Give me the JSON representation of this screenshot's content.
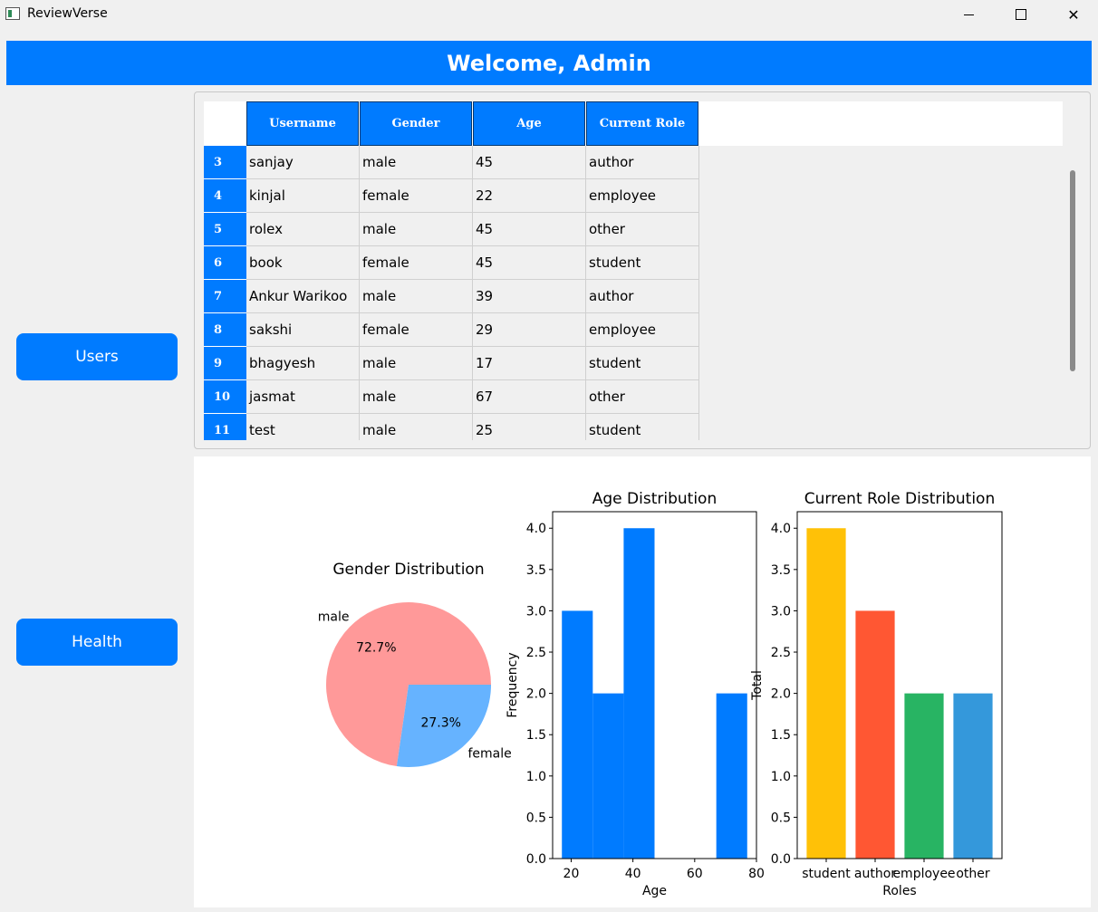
{
  "window": {
    "title": "ReviewVerse",
    "controls": {
      "minimize": "",
      "maximize": "",
      "close": "✕"
    }
  },
  "header": {
    "title": "Welcome, Admin"
  },
  "sidebar": {
    "users_label": "Users",
    "health_label": "Health"
  },
  "table": {
    "columns": [
      "Username",
      "Gender",
      "Age",
      "Current Role"
    ],
    "rows": [
      {
        "id": "3",
        "cells": [
          "sanjay",
          "male",
          "45",
          "author"
        ]
      },
      {
        "id": "4",
        "cells": [
          "kinjal",
          "female",
          "22",
          "employee"
        ]
      },
      {
        "id": "5",
        "cells": [
          "rolex",
          "male",
          "45",
          "other"
        ]
      },
      {
        "id": "6",
        "cells": [
          "book",
          "female",
          "45",
          "student"
        ]
      },
      {
        "id": "7",
        "cells": [
          "Ankur Warikoo",
          "male",
          "39",
          "author"
        ]
      },
      {
        "id": "8",
        "cells": [
          "sakshi",
          "female",
          "29",
          "employee"
        ]
      },
      {
        "id": "9",
        "cells": [
          "bhagyesh",
          "male",
          "17",
          "student"
        ]
      },
      {
        "id": "10",
        "cells": [
          "jasmat",
          "male",
          "67",
          "other"
        ]
      },
      {
        "id": "11",
        "cells": [
          "test",
          "male",
          "25",
          "student"
        ]
      }
    ]
  },
  "chart_data": [
    {
      "type": "pie",
      "title": "Gender Distribution",
      "categories": [
        "male",
        "female"
      ],
      "values": [
        72.7,
        27.3
      ],
      "value_labels": [
        "72.7%",
        "27.3%"
      ],
      "colors": [
        "#ff9999",
        "#66b3ff"
      ]
    },
    {
      "type": "bar",
      "title": "Age Distribution",
      "xlabel": "Age",
      "ylabel": "Frequency",
      "bins": [
        [
          17,
          27
        ],
        [
          27,
          37
        ],
        [
          37,
          47
        ],
        [
          47,
          57
        ],
        [
          57,
          67
        ],
        [
          67,
          77
        ]
      ],
      "values": [
        3,
        2,
        4,
        0,
        0,
        2
      ],
      "xlim": [
        14,
        80
      ],
      "ylim": [
        0,
        4.2
      ],
      "xticks": [
        "20",
        "40",
        "60",
        "80"
      ],
      "xtick_values": [
        20,
        40,
        60,
        80
      ],
      "yticks": [
        "0.0",
        "0.5",
        "1.0",
        "1.5",
        "2.0",
        "2.5",
        "3.0",
        "3.5",
        "4.0"
      ],
      "color": "#007bff"
    },
    {
      "type": "bar",
      "title": "Current Role Distribution",
      "xlabel": "Roles",
      "ylabel": "Total",
      "categories": [
        "student",
        "author",
        "employee",
        "other"
      ],
      "values": [
        4,
        3,
        2,
        2
      ],
      "ylim": [
        0,
        4.2
      ],
      "yticks": [
        "0.0",
        "0.5",
        "1.0",
        "1.5",
        "2.0",
        "2.5",
        "3.0",
        "3.5",
        "4.0"
      ],
      "colors": [
        "#ffc107",
        "#ff5733",
        "#28b463",
        "#3498db"
      ]
    }
  ]
}
